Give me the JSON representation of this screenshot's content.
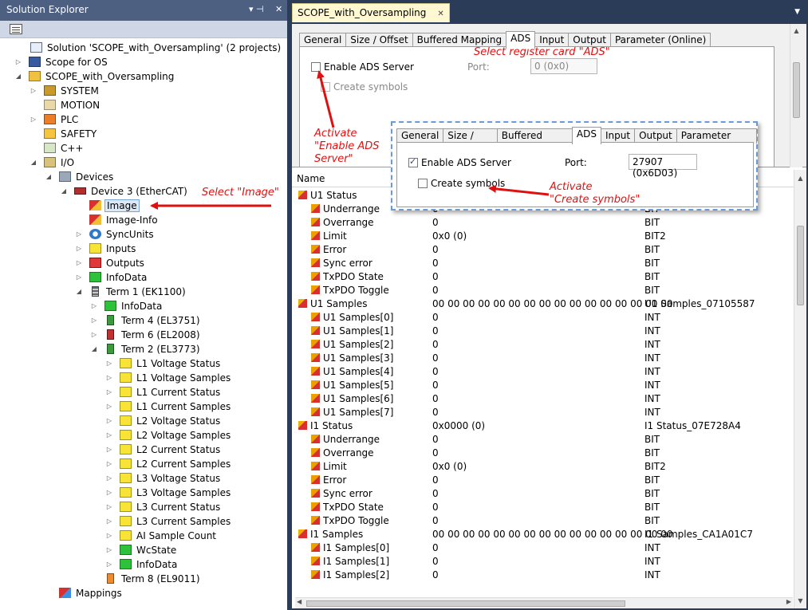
{
  "solution_explorer": {
    "title": "Solution Explorer",
    "pin_glyph": "▾ ⊣",
    "close_glyph": "✕",
    "tree": [
      {
        "label": "Solution 'SCOPE_with_Oversampling' (2 projects)",
        "icon": "solution-icon"
      },
      {
        "label": "Scope for OS",
        "icon": "scope-project-icon"
      },
      {
        "label": "SCOPE_with_Oversampling",
        "icon": "twincat-project-icon"
      },
      {
        "label": "SYSTEM",
        "icon": "system-icon"
      },
      {
        "label": "MOTION",
        "icon": "motion-icon"
      },
      {
        "label": "PLC",
        "icon": "plc-icon"
      },
      {
        "label": "SAFETY",
        "icon": "safety-icon"
      },
      {
        "label": "C++",
        "icon": "cpp-icon"
      },
      {
        "label": "I/O",
        "icon": "io-icon"
      },
      {
        "label": "Devices",
        "icon": "devices-icon"
      },
      {
        "label": "Device 3 (EtherCAT)",
        "icon": "ethercat-device-icon"
      },
      {
        "label": "Image",
        "icon": "image-icon"
      },
      {
        "label": "Image-Info",
        "icon": "image-info-icon"
      },
      {
        "label": "SyncUnits",
        "icon": "syncunits-icon"
      },
      {
        "label": "Inputs",
        "icon": "inputs-icon"
      },
      {
        "label": "Outputs",
        "icon": "outputs-icon"
      },
      {
        "label": "InfoData",
        "icon": "infodata-icon"
      },
      {
        "label": "Term 1 (EK1100)",
        "icon": "terminal-icon"
      },
      {
        "label": "InfoData",
        "icon": "infodata-icon"
      },
      {
        "label": "Term 4 (EL3751)",
        "icon": "terminal-icon"
      },
      {
        "label": "Term 6 (EL2008)",
        "icon": "terminal-icon"
      },
      {
        "label": "Term 2 (EL3773)",
        "icon": "terminal-icon"
      },
      {
        "label": "L1 Voltage Status",
        "icon": "input-var-icon"
      },
      {
        "label": "L1 Voltage Samples",
        "icon": "input-var-icon"
      },
      {
        "label": "L1 Current Status",
        "icon": "input-var-icon"
      },
      {
        "label": "L1 Current Samples",
        "icon": "input-var-icon"
      },
      {
        "label": "L2 Voltage Status",
        "icon": "input-var-icon"
      },
      {
        "label": "L2 Voltage Samples",
        "icon": "input-var-icon"
      },
      {
        "label": "L2 Current Status",
        "icon": "input-var-icon"
      },
      {
        "label": "L2 Current Samples",
        "icon": "input-var-icon"
      },
      {
        "label": "L3 Voltage Status",
        "icon": "input-var-icon"
      },
      {
        "label": "L3 Voltage Samples",
        "icon": "input-var-icon"
      },
      {
        "label": "L3 Current Status",
        "icon": "input-var-icon"
      },
      {
        "label": "L3 Current Samples",
        "icon": "input-var-icon"
      },
      {
        "label": "AI Sample Count",
        "icon": "input-var-icon"
      },
      {
        "label": "WcState",
        "icon": "wcstate-icon"
      },
      {
        "label": "InfoData",
        "icon": "infodata-icon"
      },
      {
        "label": "Term 8 (EL9011)",
        "icon": "terminal-icon"
      },
      {
        "label": "Mappings",
        "icon": "mappings-icon"
      }
    ],
    "annotation_select_image": "Select \"Image\""
  },
  "document": {
    "tab_title": "SCOPE_with_Oversampling",
    "tab_close": "✕",
    "tabs_top": [
      "General",
      "Size / Offset",
      "Buffered Mapping",
      "ADS",
      "Input",
      "Output",
      "Parameter (Online)"
    ],
    "enable_ads_label": "Enable ADS Server",
    "port_label": "Port:",
    "port_value_top": "0 (0x0)",
    "create_symbols_label": "Create symbols",
    "annotation_select_card": "Select register card \"ADS\"",
    "annotation_enable_ads": [
      "Activate",
      "\"Enable ADS",
      "Server\""
    ],
    "popup": {
      "tabs": [
        "General",
        "Size / Offset",
        "Buffered Mapping",
        "ADS",
        "Input",
        "Output",
        "Parameter (Online)"
      ],
      "enable_ads_label": "Enable ADS Server",
      "port_label": "Port:",
      "port_value": "27907 (0x6D03)",
      "create_symbols_label": "Create symbols"
    },
    "annotation_create_symbols": [
      "Activate",
      "\"Create symbols\""
    ],
    "list": {
      "col_name": "Name",
      "rows": [
        {
          "name": "U1 Status",
          "value": "",
          "type": "",
          "group": true
        },
        {
          "name": "Underrange",
          "value": "0",
          "type": "BIT"
        },
        {
          "name": "Overrange",
          "value": "0",
          "type": "BIT"
        },
        {
          "name": "Limit",
          "value": "0x0 (0)",
          "type": "BIT2"
        },
        {
          "name": "Error",
          "value": "0",
          "type": "BIT"
        },
        {
          "name": "Sync error",
          "value": "0",
          "type": "BIT"
        },
        {
          "name": "TxPDO State",
          "value": "0",
          "type": "BIT"
        },
        {
          "name": "TxPDO Toggle",
          "value": "0",
          "type": "BIT"
        },
        {
          "name": "U1 Samples",
          "value": "00 00 00 00 00 00 00 00 00 00 00 00 00 00 00 00",
          "type": "U1 Samples_07105587",
          "group": true
        },
        {
          "name": "U1 Samples[0]",
          "value": "0",
          "type": "INT"
        },
        {
          "name": "U1 Samples[1]",
          "value": "0",
          "type": "INT"
        },
        {
          "name": "U1 Samples[2]",
          "value": "0",
          "type": "INT"
        },
        {
          "name": "U1 Samples[3]",
          "value": "0",
          "type": "INT"
        },
        {
          "name": "U1 Samples[4]",
          "value": "0",
          "type": "INT"
        },
        {
          "name": "U1 Samples[5]",
          "value": "0",
          "type": "INT"
        },
        {
          "name": "U1 Samples[6]",
          "value": "0",
          "type": "INT"
        },
        {
          "name": "U1 Samples[7]",
          "value": "0",
          "type": "INT"
        },
        {
          "name": "I1 Status",
          "value": "0x0000 (0)",
          "type": "I1 Status_07E728A4",
          "group": true
        },
        {
          "name": "Underrange",
          "value": "0",
          "type": "BIT"
        },
        {
          "name": "Overrange",
          "value": "0",
          "type": "BIT"
        },
        {
          "name": "Limit",
          "value": "0x0 (0)",
          "type": "BIT2"
        },
        {
          "name": "Error",
          "value": "0",
          "type": "BIT"
        },
        {
          "name": "Sync error",
          "value": "0",
          "type": "BIT"
        },
        {
          "name": "TxPDO State",
          "value": "0",
          "type": "BIT"
        },
        {
          "name": "TxPDO Toggle",
          "value": "0",
          "type": "BIT"
        },
        {
          "name": "I1 Samples",
          "value": "00 00 00 00 00 00 00 00 00 00 00 00 00 00 00 00",
          "type": "I1 Samples_CA1A01C7",
          "group": true
        },
        {
          "name": "I1 Samples[0]",
          "value": "0",
          "type": "INT"
        },
        {
          "name": "I1 Samples[1]",
          "value": "0",
          "type": "INT"
        },
        {
          "name": "I1 Samples[2]",
          "value": "0",
          "type": "INT"
        }
      ]
    }
  },
  "colors": {
    "annotation": "#e01010",
    "titlebar": "#4d6082",
    "background": "#2b3c59",
    "tab_active": "#fff8d0"
  }
}
